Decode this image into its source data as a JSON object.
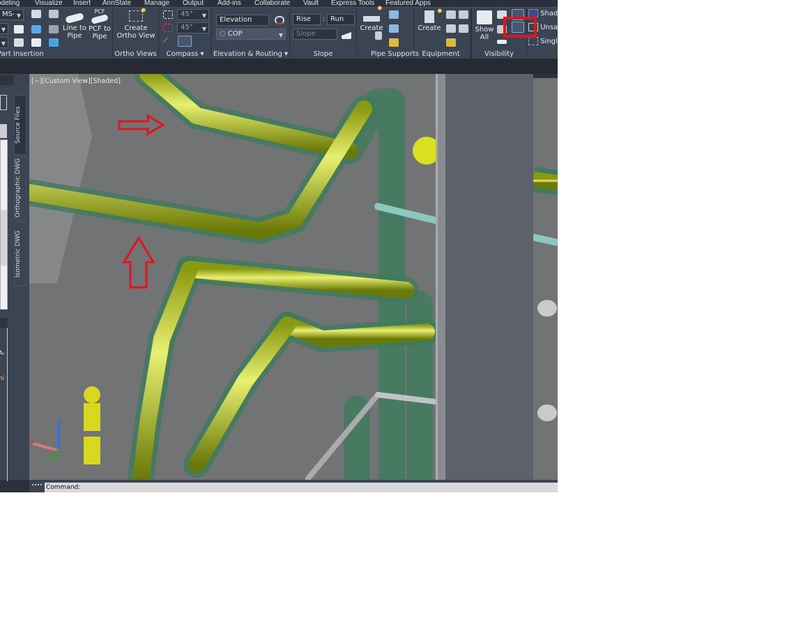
{
  "ribbon_tabs": [
    "odeling",
    "Visualize",
    "Insert",
    "AnnState",
    "Manage",
    "Output",
    "Add-ins",
    "Collaborate",
    "Vault",
    "Express Tools",
    "Featured Apps"
  ],
  "panels": {
    "part_insertion": {
      "label": "Part Insertion",
      "combo": "MS-",
      "line_to_pipe": "Line to Pipe",
      "pcf_to_pipe": "PCF to Pipe",
      "pcf_icon": "PCF"
    },
    "ortho_views": {
      "label": "Ortho Views",
      "create": "Create Ortho View"
    },
    "compass": {
      "label": "Compass",
      "angle1": "45°",
      "angle2": "45°"
    },
    "elevation": {
      "label": "Elevation & Routing",
      "elevation": "Elevation",
      "cop": "COP"
    },
    "slope": {
      "label": "Slope",
      "rise": "Rise",
      "run": "Run",
      "slope": "Slope"
    },
    "pipe_supports": {
      "label": "Pipe Supports",
      "create": "Create"
    },
    "equipment": {
      "label": "Equipment",
      "create": "Create"
    },
    "visibility": {
      "label": "Visibility",
      "show_all": "Show All"
    },
    "visual": {
      "shaded": "Shad",
      "unsaved": "Unsav",
      "single": "Singl"
    }
  },
  "viewport": {
    "label": "[−][Custom View][Shaded]"
  },
  "palette_tabs": [
    "Source Files",
    "Orthographic DWG",
    "Isometric DWG"
  ],
  "palette_fragments": [
    "A-",
    "hi"
  ],
  "ucs": {
    "x": "X",
    "y": "Y",
    "z": "Z"
  },
  "command": {
    "prompt": "Command:"
  },
  "colors": {
    "annotation": "#e0141e",
    "pipe": "#c8d82a",
    "insulation": "#2e7d5b",
    "ribbon": "#3b4453"
  }
}
